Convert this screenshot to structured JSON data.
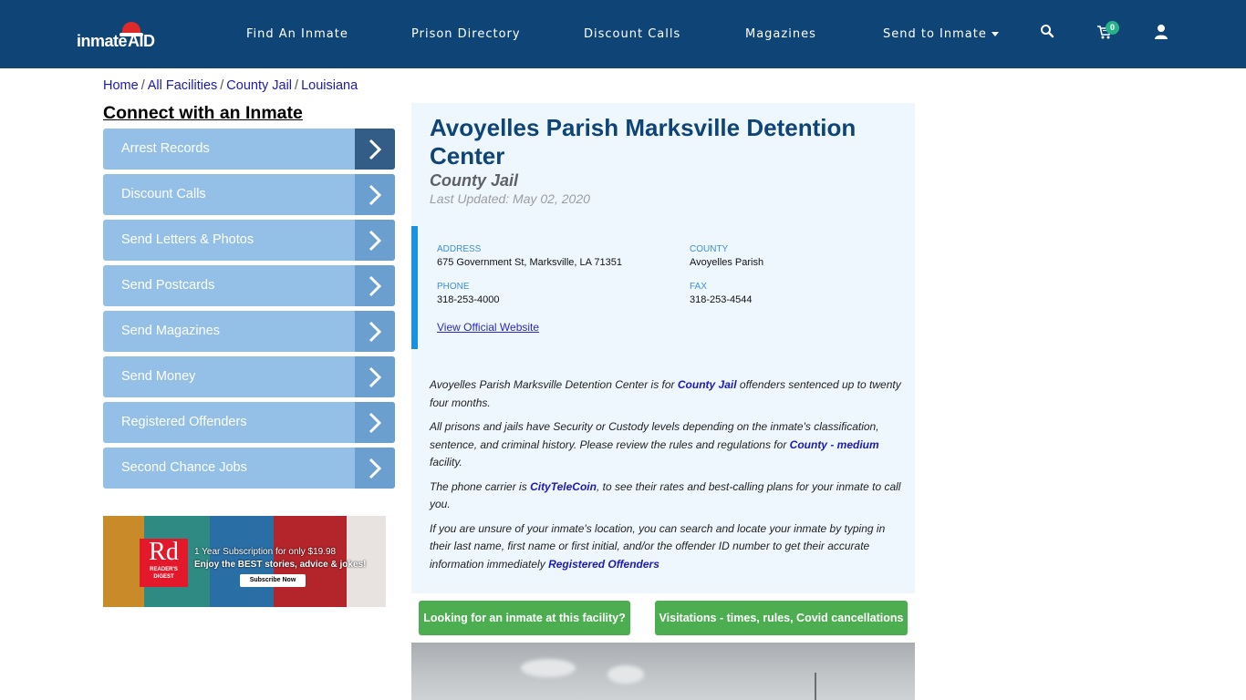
{
  "navbar": {
    "logo_text_1": "inmate",
    "logo_text_2": "AID",
    "links": [
      {
        "label": "Find An Inmate"
      },
      {
        "label": "Prison Directory"
      },
      {
        "label": "Discount Calls"
      },
      {
        "label": "Magazines"
      },
      {
        "label": "Send to Inmate",
        "has_dropdown": true
      }
    ],
    "icons": [
      "search-icon",
      "cart-icon",
      "user-icon"
    ],
    "cart_count": "0",
    "colors": {
      "bar": "#0f4477",
      "badge": "#27b38a"
    }
  },
  "breadcrumb": {
    "items": [
      "Home",
      "All Facilities",
      "County Jail",
      "Louisiana"
    ],
    "separator": "/"
  },
  "sidebar": {
    "title": "Connect with an Inmate",
    "items": [
      {
        "label": "Arrest Records",
        "active": true
      },
      {
        "label": "Discount Calls"
      },
      {
        "label": "Send Letters & Photos"
      },
      {
        "label": "Send Postcards"
      },
      {
        "label": "Send Magazines"
      },
      {
        "label": "Send Money"
      },
      {
        "label": "Registered Offenders"
      },
      {
        "label": "Second Chance Jobs"
      }
    ],
    "ad": {
      "brand_big": "Rd",
      "brand_small_1": "READER'S",
      "brand_small_2": "DIGEST",
      "line1": "1 Year Subscription for only $19.98",
      "line2": "Enjoy the BEST stories, advice & jokes!",
      "cta": "Subscribe Now"
    }
  },
  "facility": {
    "title": "Avoyelles Parish Marksville Detention Center",
    "type": "County Jail",
    "last_updated": "Last Updated: May 02, 2020",
    "info": {
      "address_label": "ADDRESS",
      "address": "675 Government St, Marksville, LA 71351",
      "county_label": "COUNTY",
      "county": "Avoyelles Parish",
      "phone_label": "PHONE",
      "phone": "318-253-4000",
      "fax_label": "FAX",
      "fax": "318-253-4544",
      "website_link": "View Official Website"
    },
    "description": {
      "p1_a": "Avoyelles Parish Marksville Detention Center is for ",
      "p1_link": "County Jail",
      "p1_b": " offenders sentenced up to twenty four months.",
      "p2_a": "All prisons and jails have Security or Custody levels depending on the inmate's classification, sentence, and criminal history. Please review the rules and regulations for ",
      "p2_link": "County - medium",
      "p2_b": " facility.",
      "p3_a": "The phone carrier is ",
      "p3_link": "CityTeleCoin",
      "p3_b": ", to see their rates and best-calling plans for your inmate to call you.",
      "p4_a": "If you are unsure of your inmate's location, you can search and locate your inmate by typing in their last name, first name or first initial, and/or the offender ID number to get their accurate information immediately ",
      "p4_link": "Registered Offenders"
    },
    "buttons": {
      "find_inmate": "Looking for an inmate at this facility?",
      "visitation": "Visitations - times, rules, Covid cancellations"
    }
  }
}
